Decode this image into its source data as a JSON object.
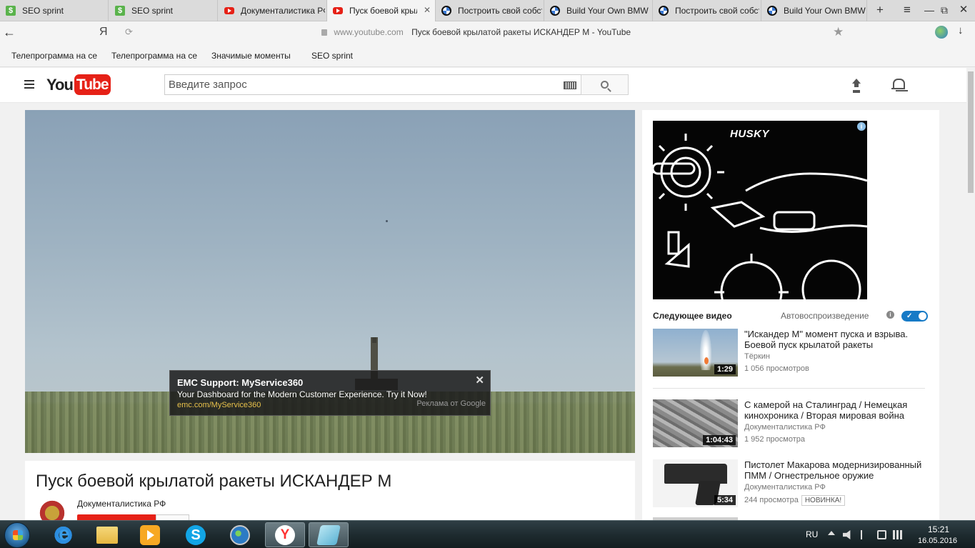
{
  "browser": {
    "tabs": [
      {
        "label": "SEO sprint",
        "icon": "seo-sprint-icon"
      },
      {
        "label": "SEO sprint",
        "icon": "seo-sprint-icon"
      },
      {
        "label": "Документалистика РФ",
        "icon": "youtube-icon"
      },
      {
        "label": "Пуск боевой крылатой ракеты ИСКАНДЕР М",
        "icon": "youtube-icon",
        "active": true
      },
      {
        "label": "Построить свой собственный BMW",
        "icon": "bmw-icon"
      },
      {
        "label": "Build Your Own BMW",
        "icon": "bmw-icon"
      },
      {
        "label": "Построить свой собственный BMW",
        "icon": "bmw-icon"
      },
      {
        "label": "Build Your Own BMW",
        "icon": "bmw-icon"
      }
    ],
    "new_tab_symbol": "+",
    "menu_symbol": "≡",
    "restore_symbol": "⧉",
    "close_symbol": "✕",
    "tab_close_symbol": "✕",
    "back_symbol": "←",
    "yandex_symbol": "Я",
    "reload_symbol": "⟳",
    "url_host": "www.youtube.com",
    "url_title": "Пуск боевой крылатой ракеты ИСКАНДЕР М - YouTube",
    "star_symbol": "★",
    "download_symbol": "↓",
    "bookmarks": [
      {
        "label": "Телепрограмма на се"
      },
      {
        "label": "Телепрограмма на се"
      },
      {
        "label": "Значимые моменты"
      },
      {
        "label": "SEO sprint"
      }
    ]
  },
  "youtube": {
    "logo_you": "You",
    "logo_tube": "Tube",
    "search_placeholder": "Введите запрос",
    "video": {
      "title": "Пуск боевой крылатой ракеты ИСКАНДЕР М",
      "channel": "Документалистика РФ"
    },
    "player_ad": {
      "title": "EMC Support: MyService360",
      "description": "Your Dashboard for the Modern Customer Experience. Try it Now!",
      "link": "emc.com/MyService360",
      "attribution": "Реклама от Google",
      "close_symbol": "✕"
    },
    "sidebar_ad": {
      "brand": "HUSKY",
      "info_symbol": "i"
    },
    "up_next": {
      "label": "Следующее видео",
      "autoplay_label": "Автовоспроизведение",
      "autoplay_on": true,
      "check_symbol": "✓",
      "info_symbol": "i"
    },
    "related": [
      {
        "title": "\"Искандер М\" момент пуска и взрыва. Боевой пуск крылатой ракеты",
        "channel": "Тёркин",
        "views": "1 056 просмотров",
        "duration": "1:29",
        "badge": ""
      },
      {
        "title": "С камерой на Сталинград / Немецкая кинохроника / Вторая мировая война",
        "channel": "Документалистика РФ",
        "views": "1 952 просмотра",
        "duration": "1:04:43",
        "badge": ""
      },
      {
        "title": "Пистолет Макарова модернизированный ПММ / Огнестрельное оружие",
        "channel": "Документалистика РФ",
        "views": "244 просмотра",
        "duration": "5:34",
        "badge": "НОВИНКА!"
      }
    ]
  },
  "taskbar": {
    "language": "RU",
    "time": "15:21",
    "date": "16.05.2016",
    "apps": [
      {
        "name": "internet-explorer-icon",
        "active": false
      },
      {
        "name": "file-explorer-icon",
        "active": false
      },
      {
        "name": "media-player-icon",
        "active": false
      },
      {
        "name": "skype-icon",
        "active": false
      },
      {
        "name": "google-earth-icon",
        "active": false
      },
      {
        "name": "yandex-browser-icon",
        "active": true
      },
      {
        "name": "app-icon",
        "active": false
      }
    ],
    "skype_letter": "S",
    "yandex_letter": "Y"
  }
}
